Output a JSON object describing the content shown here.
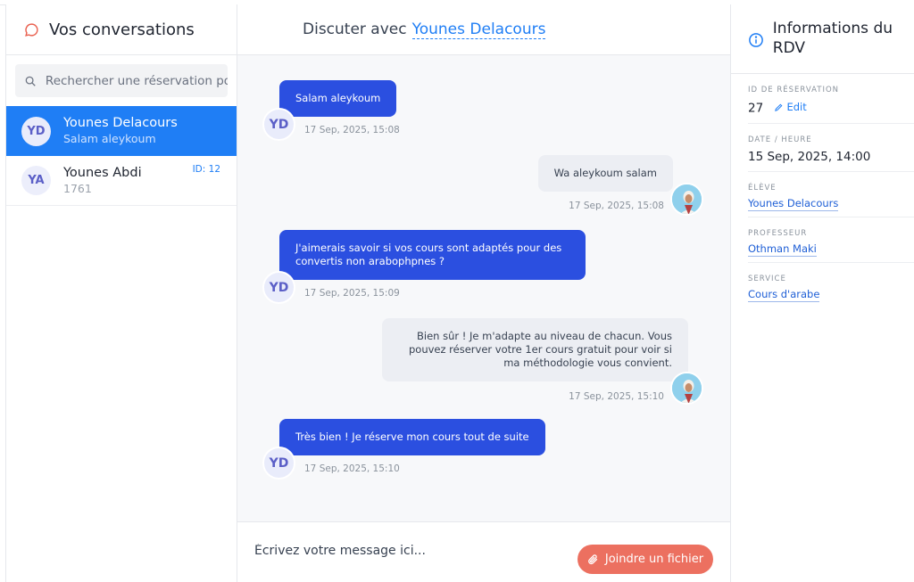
{
  "sidebar": {
    "title": "Vos conversations",
    "search_placeholder": "Rechercher une réservation pour",
    "conversations": [
      {
        "initials": "YD",
        "name": "Younes Delacours",
        "preview": "Salam aleykoum",
        "badge": ""
      },
      {
        "initials": "YA",
        "name": "Younes Abdi",
        "preview": "1761",
        "badge": "ID: 12"
      }
    ]
  },
  "chat": {
    "title_prefix": "Discuter avec",
    "contact_name": "Younes Delacours",
    "messages": [
      {
        "direction": "in",
        "initials": "YD",
        "text": "Salam aleykoum",
        "time": "17 Sep, 2025, 15:08"
      },
      {
        "direction": "out",
        "text": "Wa aleykoum salam",
        "time": "17 Sep, 2025, 15:08"
      },
      {
        "direction": "in",
        "initials": "YD",
        "text": "J'aimerais savoir si vos cours sont adaptés pour des convertis non arabophpnes ?",
        "time": "17 Sep, 2025, 15:09"
      },
      {
        "direction": "out",
        "text": "Bien sûr ! Je m'adapte au niveau de chacun. Vous pouvez réserver votre 1er cours gratuit pour voir si ma méthodologie vous convient.",
        "time": "17 Sep, 2025, 15:10"
      },
      {
        "direction": "in",
        "initials": "YD",
        "text": "Très bien ! Je réserve mon cours tout de suite",
        "time": "17 Sep, 2025, 15:10"
      }
    ],
    "composer_placeholder": "Écrivez votre message ici...",
    "attach_label": "Joindre un fichier"
  },
  "details": {
    "title": "Informations du RDV",
    "reservation_label": "ID DE RÉSERVATION",
    "reservation_id": "27",
    "edit_label": "Edit",
    "datetime_label": "DATE / HEURE",
    "datetime": "15 Sep, 2025, 14:00",
    "student_label": "ÉLÈVE",
    "student": "Younes Delacours",
    "teacher_label": "PROFESSEUR",
    "teacher": "Othman Maki",
    "service_label": "SERVICE",
    "service": "Cours d'arabe"
  },
  "colors": {
    "accent": "#1f7ef5",
    "bubble_in": "#2b4fe0",
    "bubble_out": "#eceef3",
    "attach_button": "#ec7060"
  }
}
